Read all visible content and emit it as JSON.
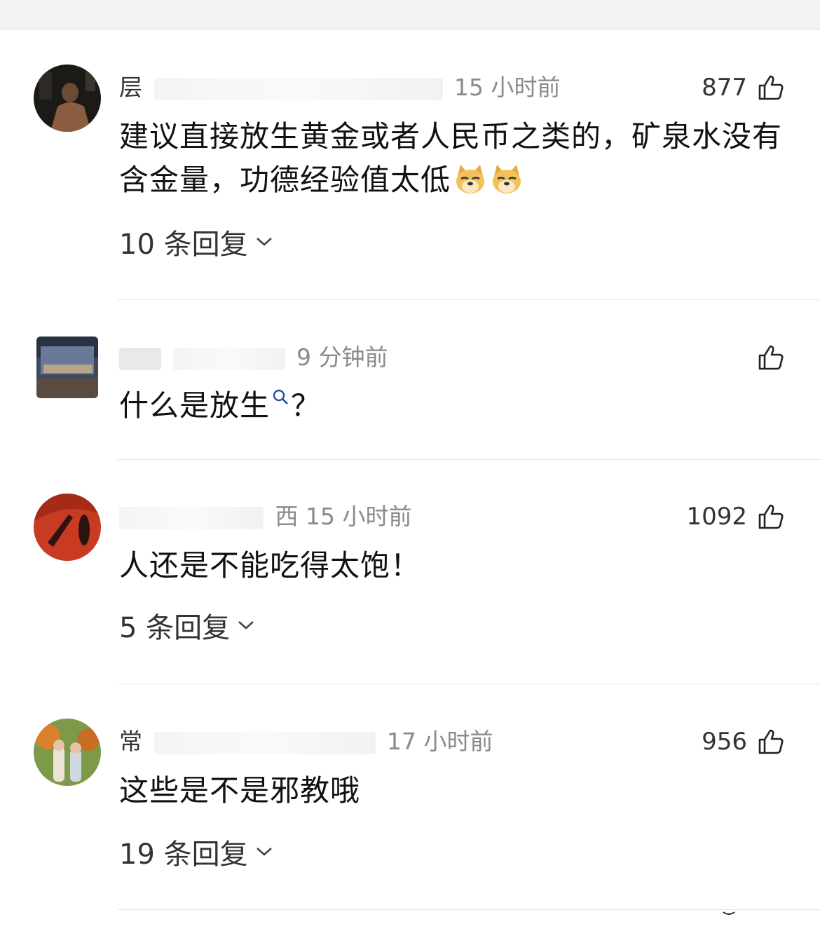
{
  "comments": [
    {
      "user": "层",
      "time": "15 小时前",
      "likes": "877",
      "text": "建议直接放生黄金或者人民币之类的，矿泉水没有含金量，功德经验值太低",
      "replies": "10 条回复"
    },
    {
      "user": "",
      "time": "9 分钟前",
      "likes": "",
      "text_a": "什么是放生",
      "text_b": "？",
      "replies": ""
    },
    {
      "user": "",
      "time": "西 15 小时前",
      "likes": "1092",
      "text": "人还是不能吃得太饱！",
      "replies": "5 条回复"
    },
    {
      "user": "常",
      "time": "17 小时前",
      "likes": "956",
      "text": "这些是不是邪教哦",
      "replies": "19 条回复"
    }
  ],
  "icons": {
    "like": "thumbs-up-icon",
    "expand": "chevron-down-icon",
    "search": "search-icon",
    "emoji": "doge-emoji"
  },
  "colors": {
    "meta": "#8a8a8a",
    "text": "#111111",
    "divider": "#e6e6e6"
  }
}
